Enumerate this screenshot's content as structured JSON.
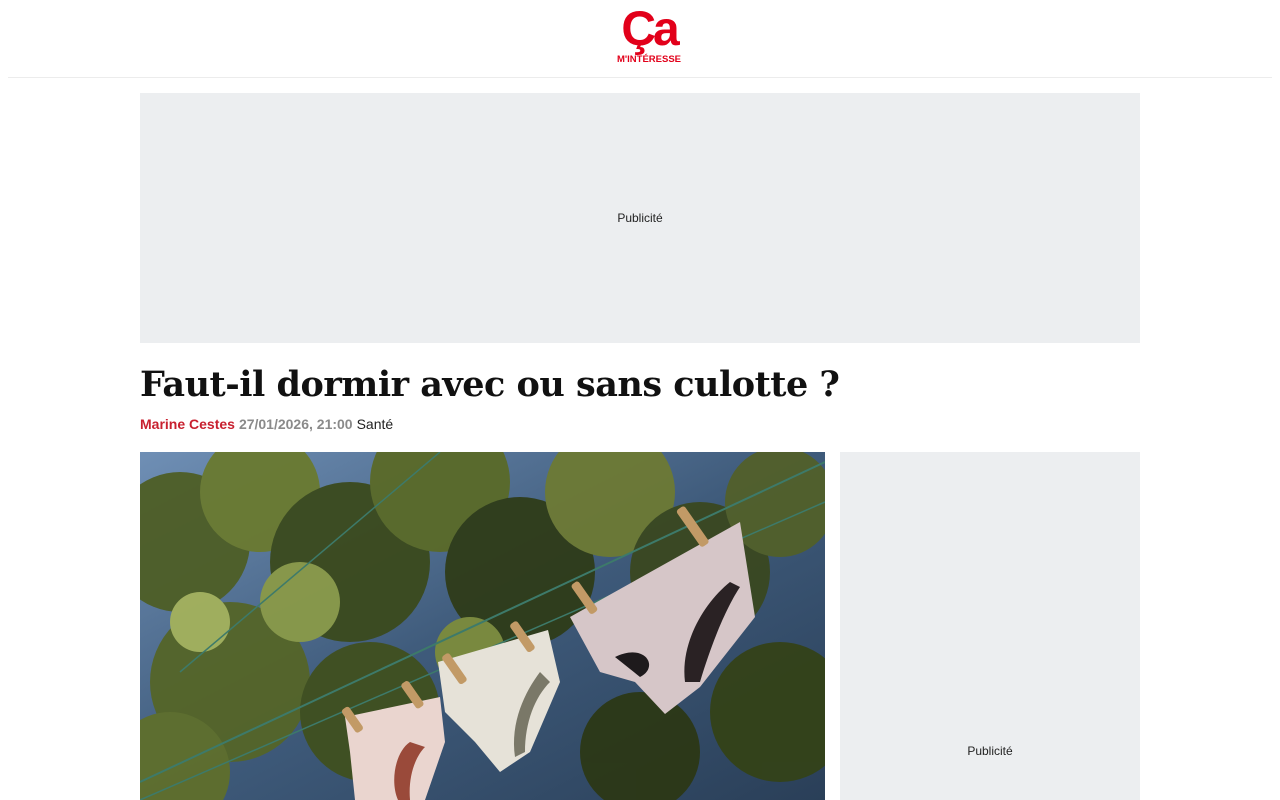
{
  "header": {
    "logo": {
      "main": "Ça",
      "sub": "M'INTÉRESSE",
      "color": "#e2001a"
    }
  },
  "ads": {
    "top_label": "Publicité",
    "side_label": "Publicité"
  },
  "article": {
    "title": "Faut-il dormir avec ou sans culotte ?",
    "author": "Marine Cestes",
    "date": "27/01/2026, 21:00",
    "category": "Santé",
    "accent_color": "#c8202f"
  }
}
